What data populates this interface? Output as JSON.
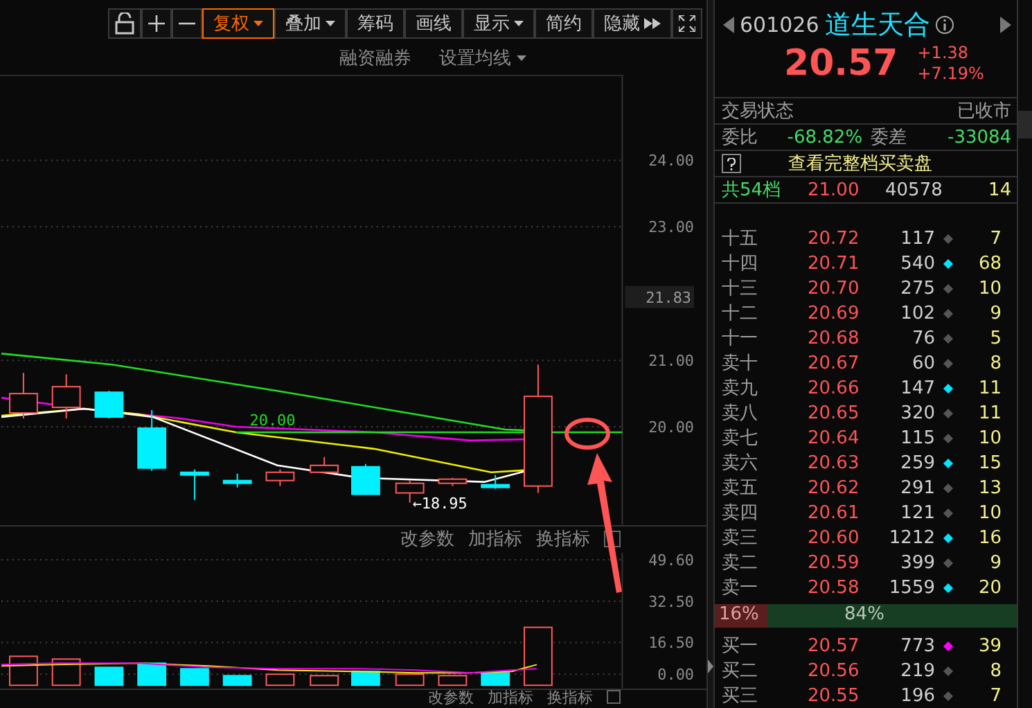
{
  "toolbar": {
    "buttons": [
      {
        "label": "复权",
        "kind": "dropdown",
        "selected": true
      },
      {
        "label": "叠加",
        "kind": "dropdown",
        "selected": false
      },
      {
        "label": "筹码",
        "kind": "plain",
        "selected": false
      },
      {
        "label": "画线",
        "kind": "plain",
        "selected": false
      },
      {
        "label": "显示",
        "kind": "dropdown",
        "selected": false
      },
      {
        "label": "简约",
        "kind": "plain",
        "selected": false
      },
      {
        "label": "隐藏",
        "kind": "more",
        "selected": false
      }
    ]
  },
  "chart_links": {
    "margin": "融资融券",
    "ma_settings": "设置均线"
  },
  "price_chart": {
    "y_axis": [
      "24.00",
      "23.00",
      "21.00",
      "20.00"
    ],
    "current_marker": "21.83",
    "line_label": "20.00",
    "low_label": "←18.95"
  },
  "indicator_pane": {
    "actions": [
      "改参数",
      "加指标",
      "换指标"
    ],
    "y_axis": [
      "49.60",
      "32.50",
      "16.50",
      "0.00"
    ]
  },
  "bottom_pane": {
    "actions": [
      "改参数",
      "加指标",
      "换指标"
    ]
  },
  "quote": {
    "code": "601026",
    "name": "道生天合",
    "price": "20.57",
    "change": "+1.38",
    "change_pct": "+7.19%"
  },
  "trade_status": {
    "label": "交易状态",
    "value": "已收市"
  },
  "order_ratio": {
    "label": "委比",
    "value": "-68.82%",
    "diff_label": "委差",
    "diff_value": "-33084"
  },
  "full_book_link": "查看完整档买卖盘",
  "total": {
    "label": "共54档",
    "price": "21.00",
    "volume": "40578",
    "count": "14"
  },
  "asks": [
    {
      "label": "十五",
      "price": "20.72",
      "volume": "117",
      "color": "#555555",
      "count": "7"
    },
    {
      "label": "十四",
      "price": "20.71",
      "volume": "540",
      "color": "#00e5ff",
      "count": "68"
    },
    {
      "label": "十三",
      "price": "20.70",
      "volume": "275",
      "color": "#555555",
      "count": "10"
    },
    {
      "label": "十二",
      "price": "20.69",
      "volume": "102",
      "color": "#555555",
      "count": "9"
    },
    {
      "label": "十一",
      "price": "20.68",
      "volume": "76",
      "color": "#555555",
      "count": "5"
    },
    {
      "label": "卖十",
      "price": "20.67",
      "volume": "60",
      "color": "#555555",
      "count": "8"
    },
    {
      "label": "卖九",
      "price": "20.66",
      "volume": "147",
      "color": "#00e5ff",
      "count": "11"
    },
    {
      "label": "卖八",
      "price": "20.65",
      "volume": "320",
      "color": "#555555",
      "count": "11"
    },
    {
      "label": "卖七",
      "price": "20.64",
      "volume": "115",
      "color": "#555555",
      "count": "10"
    },
    {
      "label": "卖六",
      "price": "20.63",
      "volume": "259",
      "color": "#00e5ff",
      "count": "15"
    },
    {
      "label": "卖五",
      "price": "20.62",
      "volume": "291",
      "color": "#555555",
      "count": "13"
    },
    {
      "label": "卖四",
      "price": "20.61",
      "volume": "121",
      "color": "#555555",
      "count": "10"
    },
    {
      "label": "卖三",
      "price": "20.60",
      "volume": "1212",
      "color": "#00e5ff",
      "count": "16"
    },
    {
      "label": "卖二",
      "price": "20.59",
      "volume": "399",
      "color": "#555555",
      "count": "9"
    },
    {
      "label": "卖一",
      "price": "20.58",
      "volume": "1559",
      "color": "#00e5ff",
      "count": "20"
    }
  ],
  "ratio_bar": {
    "sell": "16%",
    "buy": "84%",
    "level": 0.16
  },
  "bids": [
    {
      "label": "买一",
      "price": "20.57",
      "volume": "773",
      "color": "#ff00ff",
      "count": "39"
    },
    {
      "label": "买二",
      "price": "20.56",
      "volume": "219",
      "color": "#555555",
      "count": "8"
    },
    {
      "label": "买三",
      "price": "20.55",
      "volume": "196",
      "color": "#555555",
      "count": "7"
    }
  ]
}
